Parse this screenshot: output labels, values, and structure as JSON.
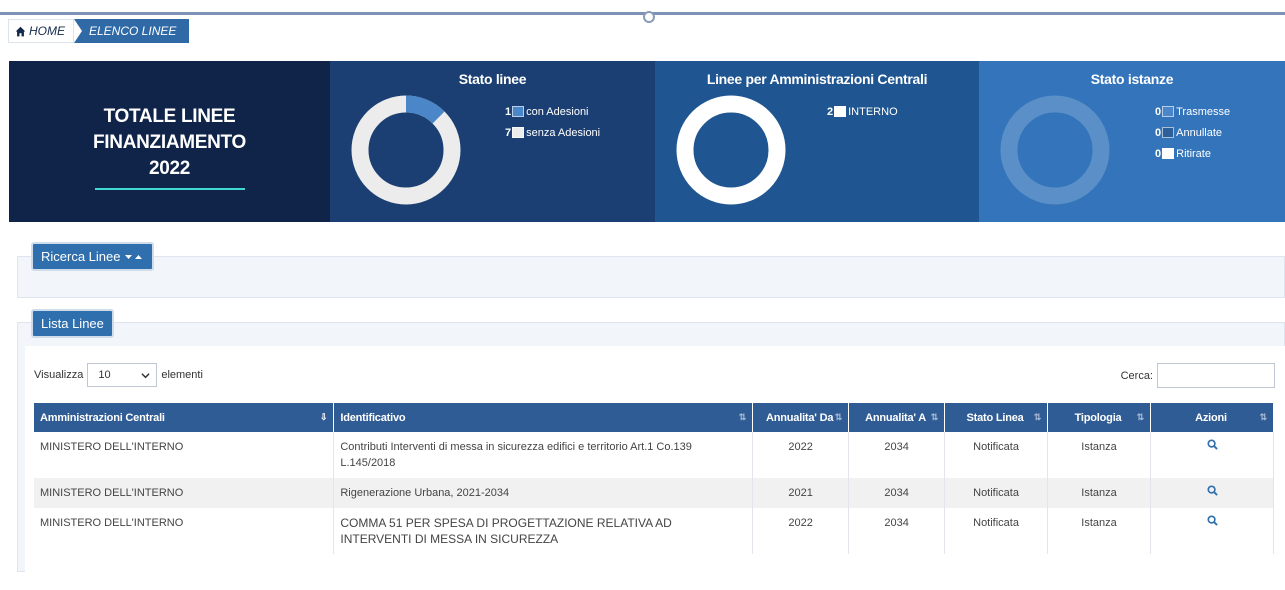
{
  "breadcrumb": {
    "home": "HOME",
    "current": "ELENCO LINEE"
  },
  "colors": {
    "navy": "#10244a",
    "panel2": "#1b3f73",
    "panel3": "#1f5591",
    "panel4": "#3374ba",
    "accent": "#3fd7cf",
    "header": "#305c95",
    "button": "#2f6fad",
    "icon": "#2f6fad"
  },
  "stats": {
    "total": {
      "line1": "TOTALE LINEE",
      "line2": "FINANZIAMENTO",
      "year": "2022"
    },
    "stato_linee": {
      "title": "Stato linee",
      "items": [
        {
          "count": "1",
          "label": "con Adesioni",
          "color": "#4a86c8"
        },
        {
          "count": "7",
          "label": "senza Adesioni",
          "color": "#ececec"
        }
      ]
    },
    "amministrazioni": {
      "title": "Linee per Amministrazioni Centrali",
      "items": [
        {
          "count": "2",
          "label": "INTERNO",
          "color": "#ffffff"
        }
      ]
    },
    "stato_istanze": {
      "title": "Stato istanze",
      "items": [
        {
          "count": "0",
          "label": "Trasmesse",
          "color": "#4a86c8"
        },
        {
          "count": "0",
          "label": "Annullate",
          "color": "#2d5f9a"
        },
        {
          "count": "0",
          "label": "Ritirate",
          "color": "#ffffff"
        }
      ]
    }
  },
  "ricerca": {
    "label": "Ricerca Linee"
  },
  "lista": {
    "label": "Lista Linee",
    "show_prefix": "Visualizza",
    "page_size": "10",
    "show_suffix": "elementi",
    "search_label": "Cerca:",
    "search_value": "",
    "columns": [
      "Amministrazioni Centrali",
      "Identificativo",
      "Annualita' Da",
      "Annualita' A",
      "Stato Linea",
      "Tipologia",
      "Azioni"
    ],
    "rows": [
      {
        "amm": "MINISTERO DELL'INTERNO",
        "id": "Contributi Interventi di messa in sicurezza edifici e territorio Art.1 Co.139 L.145/2018",
        "da": "2022",
        "a": "2034",
        "stato": "Notificata",
        "tipo": "Istanza",
        "action_icon": "search-icon"
      },
      {
        "amm": "MINISTERO DELL'INTERNO",
        "id": "Rigenerazione Urbana, 2021-2034",
        "da": "2021",
        "a": "2034",
        "stato": "Notificata",
        "tipo": "Istanza",
        "action_icon": "search-icon"
      },
      {
        "amm": "MINISTERO DELL'INTERNO",
        "id": "COMMA 51 PER SPESA DI PROGETTAZIONE RELATIVA AD INTERVENTI DI MESSA IN SICUREZZA",
        "da": "2022",
        "a": "2034",
        "stato": "Notificata",
        "tipo": "Istanza",
        "action_icon": "search-icon"
      }
    ]
  }
}
